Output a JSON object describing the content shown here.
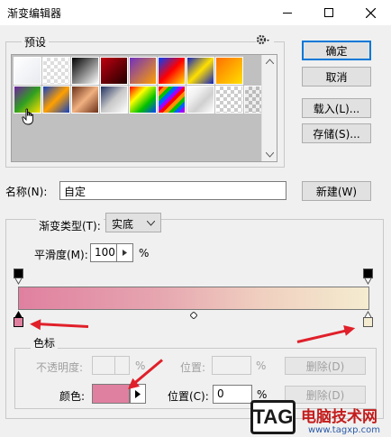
{
  "window": {
    "title": "渐变编辑器"
  },
  "presets": {
    "label": "预设"
  },
  "buttons": {
    "ok": "确定",
    "cancel": "取消",
    "load": "载入(L)...",
    "save": "存储(S)...",
    "new": "新建(W)",
    "delete1": "删除(D)",
    "delete2": "删除(D)"
  },
  "name": {
    "label": "名称(N):",
    "value": "自定"
  },
  "gradient_type": {
    "label": "渐变类型(T):",
    "value": "实底"
  },
  "smoothness": {
    "label": "平滑度(M):",
    "value": "100",
    "unit": "%"
  },
  "color_stops": {
    "label": "色标",
    "opacity_label": "不透明度:",
    "opacity_unit": "%",
    "position_label_disabled": "位置:",
    "position_unit_disabled": "%",
    "color_label": "颜色:",
    "position_label": "位置(C):",
    "position_value": "0",
    "position_unit": "%"
  },
  "colors": {
    "stop_left": "#e080a0",
    "stop_right": "#f4ecd0",
    "arrow": "#e0202a"
  },
  "watermark": {
    "tag": "TAG",
    "title": "电脑技术网",
    "url": "www.tagxp.com"
  }
}
